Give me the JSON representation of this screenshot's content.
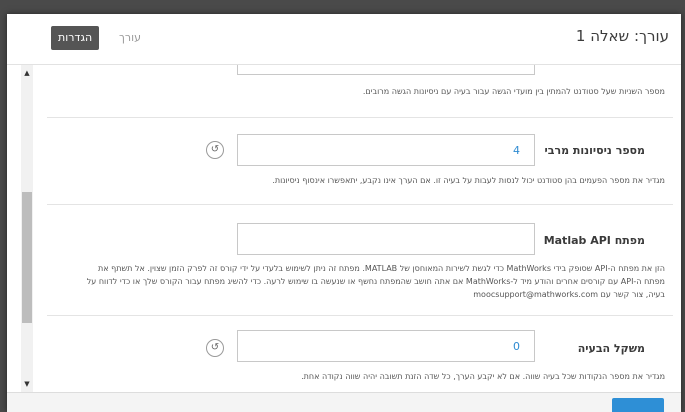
{
  "header": {
    "title": "עורך: שאלה 1",
    "settings_label": "הגדרות",
    "editor_label": "עורך"
  },
  "top_section": {
    "help": "מספר השניות שעל סטודנט להמתין בין מועדי הגשה עבור בעיה עם ניסיונות הגשה מרובים."
  },
  "max_attempts": {
    "label": "מספר ניסיונות מרבי",
    "value": "4",
    "help": "מגדיר את מספר הפעמים בהן סטודנט יכול לנסות לעבות על בעיה זו. אם הערך אינו נקבע, יתאפשרו אינסוף ניסיונות.",
    "reset_icon": "undo-icon"
  },
  "matlab_api": {
    "label": "מפתח Matlab API",
    "value": "",
    "help_lines": [
      "הזן את מפתח ה-API שסופק בידי MathWorks כדי לגשת לשירות המאוחסן של MATLAB. מפתח זה ניתן לשימוש בלעדי על ידי קורס זה לפרק הזמן שצוין. אל תשתף את",
      "מפתח ה-API עם קורסים אחרים והודע מיד ל-MathWorks אם אתה חושב שהמפתח נחשף או שנעשה בו שימוש לרעה. כדי להשיג מפתח עבור הקורס שלך או כדי לדווח על",
      "בעיה, צור קשר עם moocsupport@mathworks.com"
    ]
  },
  "problem_weight": {
    "label": "משקל הבעיה",
    "value": "0",
    "help": "מגדיר את מספר הנקודות שכל בעיה שווה. אם לא יקבע הערך, כל שדה הזנת תשובה יהיה שווה נקודה אחת.",
    "reset_icon": "undo-icon"
  },
  "colors": {
    "accent": "#2e8fd6",
    "settings_button": "#555555",
    "overlay": "#4a4a4a"
  }
}
